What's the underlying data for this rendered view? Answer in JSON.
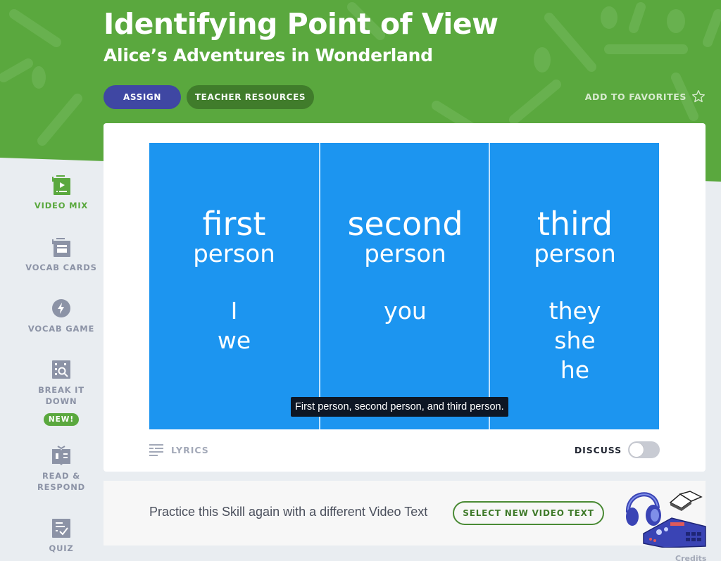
{
  "header": {
    "title": "Identifying Point of View",
    "subtitle": "Alice’s Adventures in Wonderland",
    "assign_label": "ASSIGN",
    "teacher_resources_label": "TEACHER RESOURCES",
    "favorites_label": "ADD TO FAVORITES",
    "favorites_icon": "star-outline-icon"
  },
  "colors": {
    "brand_green": "#5aa83e",
    "assign_blue": "#3f47a3",
    "video_blue": "#1c95f0"
  },
  "sidebar": {
    "items": [
      {
        "label": "VIDEO MIX",
        "icon": "video-mix-icon",
        "active": true
      },
      {
        "label": "VOCAB CARDS",
        "icon": "vocab-cards-icon",
        "active": false
      },
      {
        "label": "VOCAB GAME",
        "icon": "lightning-bolt-icon",
        "active": false
      },
      {
        "label_line1": "BREAK IT",
        "label_line2": "DOWN",
        "icon": "break-it-down-icon",
        "badge": "NEW!",
        "active": false
      },
      {
        "label_line1": "READ &",
        "label_line2": "RESPOND",
        "icon": "open-book-icon",
        "active": false
      },
      {
        "label": "QUIZ",
        "icon": "quiz-checklist-icon",
        "active": false
      }
    ]
  },
  "video": {
    "columns": [
      {
        "head": "first",
        "sub": "person",
        "words": [
          "I",
          "we"
        ]
      },
      {
        "head": "second",
        "sub": "person",
        "words": [
          "you"
        ]
      },
      {
        "head": "third",
        "sub": "person",
        "words": [
          "they",
          "she",
          "he"
        ]
      }
    ],
    "caption": "First person, second person, and third person."
  },
  "controls": {
    "lyrics_label": "LYRICS",
    "discuss_label": "DISCUSS",
    "discuss_on": false
  },
  "practice": {
    "text": "Practice this Skill again with a different Video Text",
    "button_label": "SELECT NEW VIDEO TEXT"
  },
  "footer": {
    "credits_label": "Credits"
  }
}
